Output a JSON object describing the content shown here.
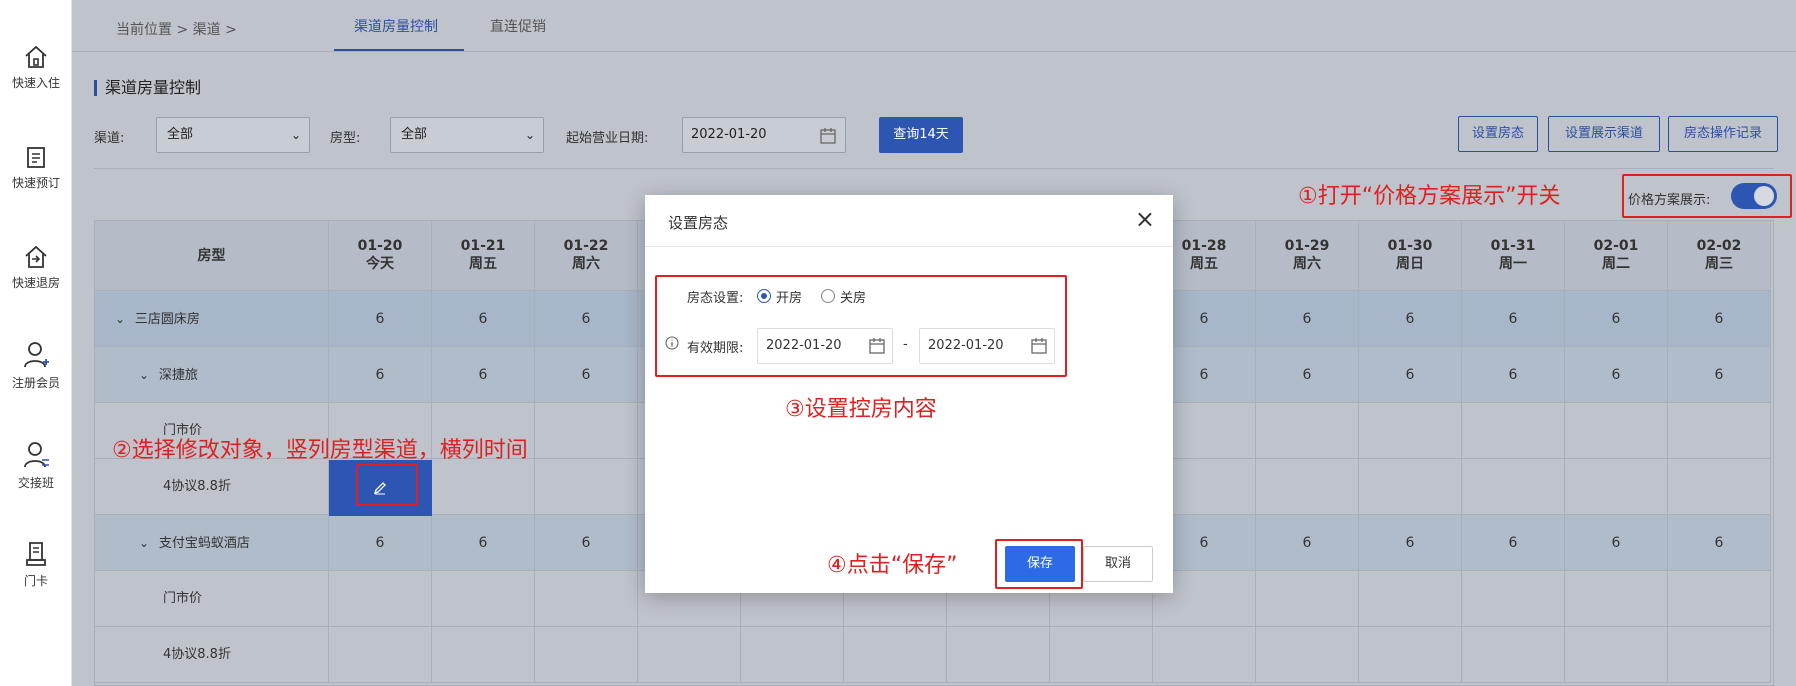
{
  "sidebar": {
    "items": [
      {
        "label": "快速入住",
        "icon": "home-key-icon"
      },
      {
        "label": "快速预订",
        "icon": "booking-list-icon"
      },
      {
        "label": "快速退房",
        "icon": "checkout-home-icon"
      },
      {
        "label": "注册会员",
        "icon": "user-add-icon"
      },
      {
        "label": "交接班",
        "icon": "shift-handover-icon"
      },
      {
        "label": "门卡",
        "icon": "door-card-icon"
      }
    ]
  },
  "breadcrumb": "当前位置 > 渠道 >",
  "tabs": [
    {
      "label": "渠道房量控制",
      "active": true
    },
    {
      "label": "直连促销",
      "active": false
    }
  ],
  "section_title": "渠道房量控制",
  "filters": {
    "channel_label": "渠道:",
    "channel_value": "全部",
    "roomtype_label": "房型:",
    "roomtype_value": "全部",
    "date_label": "起始营业日期:",
    "date_value": "2022-01-20",
    "query_button": "查询14天"
  },
  "actions": {
    "set_status": "设置房态",
    "set_display_channel": "设置展示渠道",
    "status_log": "房态操作记录"
  },
  "toggle": {
    "label": "价格方案展示:",
    "on": true
  },
  "annotations": {
    "a1": "①打开“价格方案展示”开关",
    "a2": "②选择修改对象，竖列房型渠道，横列时间",
    "a3": "③设置控房内容",
    "a4": "④点击“保存”"
  },
  "grid": {
    "header_first": "房型",
    "columns": [
      {
        "date": "01-20",
        "day": "今天"
      },
      {
        "date": "01-21",
        "day": "周五"
      },
      {
        "date": "01-22",
        "day": "周六"
      },
      {
        "date": "",
        "day": ""
      },
      {
        "date": "",
        "day": ""
      },
      {
        "date": "",
        "day": ""
      },
      {
        "date": "",
        "day": ""
      },
      {
        "date": "",
        "day": ""
      },
      {
        "date": "01-28",
        "day": "周五"
      },
      {
        "date": "01-29",
        "day": "周六"
      },
      {
        "date": "01-30",
        "day": "周日"
      },
      {
        "date": "01-31",
        "day": "周一"
      },
      {
        "date": "02-01",
        "day": "周二"
      },
      {
        "date": "02-02",
        "day": "周三"
      }
    ],
    "rows": [
      {
        "label": "三店圆床房",
        "indent": 0,
        "caret": true,
        "style": "A",
        "values": [
          "6",
          "6",
          "6",
          "",
          "",
          "",
          "",
          "",
          "6",
          "6",
          "6",
          "6",
          "6",
          "6"
        ]
      },
      {
        "label": "深捷旅",
        "indent": 1,
        "caret": true,
        "style": "B",
        "values": [
          "6",
          "6",
          "6",
          "",
          "",
          "",
          "",
          "",
          "6",
          "6",
          "6",
          "6",
          "6",
          "6"
        ]
      },
      {
        "label": "门市价",
        "indent": 2,
        "caret": false,
        "style": "C",
        "values": [
          "",
          "",
          "",
          "",
          "",
          "",
          "",
          "",
          "",
          "",
          "",
          "",
          "",
          ""
        ]
      },
      {
        "label": "4协议8.8折",
        "indent": 2,
        "caret": false,
        "style": "C",
        "values": [
          "",
          "",
          "",
          "",
          "",
          "",
          "",
          "",
          "",
          "",
          "",
          "",
          "",
          ""
        ]
      },
      {
        "label": "支付宝蚂蚁酒店",
        "indent": 1,
        "caret": true,
        "style": "B",
        "values": [
          "6",
          "6",
          "6",
          "",
          "",
          "",
          "",
          "",
          "6",
          "6",
          "6",
          "6",
          "6",
          "6"
        ]
      },
      {
        "label": "门市价",
        "indent": 2,
        "caret": false,
        "style": "C",
        "values": [
          "",
          "",
          "",
          "",
          "",
          "",
          "",
          "",
          "",
          "",
          "",
          "",
          "",
          ""
        ]
      },
      {
        "label": "4协议8.8折",
        "indent": 2,
        "caret": false,
        "style": "C",
        "values": [
          "",
          "",
          "",
          "",
          "",
          "",
          "",
          "",
          "",
          "",
          "",
          "",
          "",
          ""
        ]
      }
    ]
  },
  "modal": {
    "title": "设置房态",
    "status_label": "房态设置:",
    "open_label": "开房",
    "close_label": "关房",
    "selected": "开房",
    "validity_label": "有效期限:",
    "start_date": "2022-01-20",
    "separator": "-",
    "end_date": "2022-01-20",
    "save": "保存",
    "cancel": "取消"
  },
  "colors": {
    "accent": "#2d56b3",
    "annotation_red": "#e02020"
  }
}
